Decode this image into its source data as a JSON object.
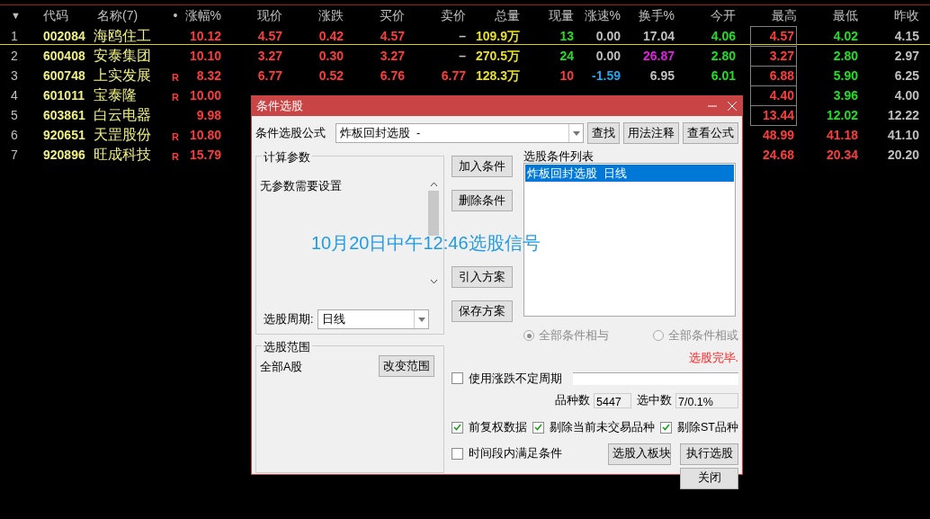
{
  "table": {
    "columns": [
      "▼",
      "代码",
      "名称(7)",
      "•",
      "涨幅%",
      "现价",
      "涨跌",
      "买价",
      "卖价",
      "总量",
      "现量",
      "涨速%",
      "换手%",
      "今开",
      "最高",
      "最低",
      "昨收"
    ],
    "rows": [
      {
        "cells": [
          {
            "text": "1"
          },
          {
            "text": "002084"
          },
          {
            "text": "海鸥住工"
          },
          null,
          {
            "text": "10.12",
            "color": "#ff3c3c"
          },
          {
            "text": "4.57",
            "color": "#ff3c3c"
          },
          {
            "text": "0.42",
            "color": "#ff3c3c"
          },
          {
            "text": "4.57",
            "color": "#ff3c3c"
          },
          {
            "text": "–",
            "color": "#c0c0c0"
          },
          {
            "text": "109.9万",
            "color": "#e8e020"
          },
          {
            "text": "13",
            "color": "#20e020"
          },
          {
            "text": "0.00",
            "color": "#c0c0c0"
          },
          {
            "text": "17.04",
            "color": "#c0c0c0"
          },
          {
            "text": "4.06",
            "color": "#20e020"
          },
          {
            "text": "4.57",
            "color": "#ff3c3c",
            "boxed": true
          },
          {
            "text": "4.02",
            "color": "#20e020"
          },
          {
            "text": "4.15",
            "color": "#c0c0c0"
          }
        ],
        "selected": true
      },
      {
        "cells": [
          {
            "text": "2"
          },
          {
            "text": "600408"
          },
          {
            "text": "安泰集团"
          },
          null,
          {
            "text": "10.10",
            "color": "#ff3c3c"
          },
          {
            "text": "3.27",
            "color": "#ff3c3c"
          },
          {
            "text": "0.30",
            "color": "#ff3c3c"
          },
          {
            "text": "3.27",
            "color": "#ff3c3c"
          },
          {
            "text": "–",
            "color": "#c0c0c0"
          },
          {
            "text": "270.5万",
            "color": "#e8e020"
          },
          {
            "text": "24",
            "color": "#20e020"
          },
          {
            "text": "0.00",
            "color": "#c0c0c0"
          },
          {
            "text": "26.87",
            "color": "#e020e0"
          },
          {
            "text": "2.80",
            "color": "#20e020"
          },
          {
            "text": "3.27",
            "color": "#ff3c3c",
            "boxed": true
          },
          {
            "text": "2.80",
            "color": "#20e020"
          },
          {
            "text": "2.97",
            "color": "#c0c0c0"
          }
        ],
        "selected": false
      },
      {
        "cells": [
          {
            "text": "3"
          },
          {
            "text": "600748"
          },
          {
            "text": "上实发展"
          },
          {
            "text": "R",
            "color": "#ff3c3c"
          },
          {
            "text": "8.32",
            "color": "#ff3c3c"
          },
          {
            "text": "6.77",
            "color": "#ff3c3c"
          },
          {
            "text": "0.52",
            "color": "#ff3c3c"
          },
          {
            "text": "6.76",
            "color": "#ff3c3c"
          },
          {
            "text": "6.77",
            "color": "#ff3c3c"
          },
          {
            "text": "128.3万",
            "color": "#e8e020"
          },
          {
            "text": "10",
            "color": "#ff3c3c"
          },
          {
            "text": "-1.59",
            "color": "#20a8f0"
          },
          {
            "text": "6.95",
            "color": "#c0c0c0"
          },
          {
            "text": "6.01",
            "color": "#20e020"
          },
          {
            "text": "6.88",
            "color": "#ff3c3c",
            "boxed": true
          },
          {
            "text": "5.90",
            "color": "#20e020"
          },
          {
            "text": "6.25",
            "color": "#c0c0c0"
          }
        ],
        "selected": false
      },
      {
        "cells": [
          {
            "text": "4"
          },
          {
            "text": "601011"
          },
          {
            "text": "宝泰隆"
          },
          {
            "text": "R",
            "color": "#ff3c3c"
          },
          {
            "text": "10.00",
            "color": "#ff3c3c"
          },
          null,
          null,
          null,
          null,
          null,
          null,
          null,
          null,
          null,
          {
            "text": "4.40",
            "color": "#ff3c3c",
            "boxed": true
          },
          {
            "text": "3.96",
            "color": "#20e020"
          },
          {
            "text": "4.00",
            "color": "#c0c0c0"
          }
        ],
        "selected": false
      },
      {
        "cells": [
          {
            "text": "5"
          },
          {
            "text": "603861"
          },
          {
            "text": "白云电器"
          },
          null,
          {
            "text": "9.98",
            "color": "#ff3c3c"
          },
          null,
          null,
          null,
          null,
          null,
          null,
          null,
          null,
          null,
          {
            "text": "13.44",
            "color": "#ff3c3c",
            "boxed": true
          },
          {
            "text": "12.02",
            "color": "#20e020"
          },
          {
            "text": "12.22",
            "color": "#c0c0c0"
          }
        ],
        "selected": false
      },
      {
        "cells": [
          {
            "text": "6"
          },
          {
            "text": "920651"
          },
          {
            "text": "天罡股份"
          },
          {
            "text": "R",
            "color": "#ff3c3c"
          },
          {
            "text": "10.80",
            "color": "#ff3c3c"
          },
          null,
          null,
          null,
          null,
          null,
          null,
          null,
          null,
          null,
          {
            "text": "48.99",
            "color": "#ff3c3c",
            "boxed": false
          },
          {
            "text": "41.18",
            "color": "#ff3c3c"
          },
          {
            "text": "41.10",
            "color": "#c0c0c0"
          }
        ],
        "selected": false
      },
      {
        "cells": [
          {
            "text": "7"
          },
          {
            "text": "920896"
          },
          {
            "text": "旺成科技"
          },
          {
            "text": "R",
            "color": "#ff3c3c"
          },
          {
            "text": "15.79",
            "color": "#ff3c3c"
          },
          null,
          null,
          null,
          null,
          null,
          null,
          null,
          null,
          null,
          {
            "text": "24.68",
            "color": "#ff3c3c",
            "boxed": false
          },
          {
            "text": "20.34",
            "color": "#ff3c3c"
          },
          {
            "text": "20.20",
            "color": "#c0c0c0"
          }
        ],
        "selected": false
      }
    ]
  },
  "dialog": {
    "title": "条件选股",
    "formula_label": "条件选股公式",
    "formula_value": "炸板回封选股  -",
    "top_buttons": [
      "查找",
      "用法注释",
      "查看公式"
    ],
    "params_group": "计算参数",
    "params_text": "无参数需要设置",
    "period_label": "选股周期:",
    "period_value": "日线",
    "range_group": "选股范围",
    "range_text": "全部A股",
    "range_button": "改变范围",
    "side_buttons": [
      "加入条件",
      "删除条件",
      "引入方案",
      "保存方案"
    ],
    "list_label": "选股条件列表",
    "list_items": [
      {
        "text": "炸板回封选股  日线",
        "selected": true
      }
    ],
    "radios": [
      {
        "label": "全部条件相与",
        "selected": true
      },
      {
        "label": "全部条件相或",
        "selected": false
      }
    ],
    "status": "选股完毕.",
    "variable_period": {
      "label": "使用涨跌不定周期",
      "checked": false
    },
    "count_label": "品种数",
    "count_value": "5447",
    "selected_label": "选中数",
    "selected_value": "7/0.1%",
    "options": [
      {
        "label": "前复权数据",
        "checked": true
      },
      {
        "label": "剔除当前未交易品种",
        "checked": true
      },
      {
        "label": "剔除ST品种",
        "checked": true
      }
    ],
    "time_range": {
      "label": "时间段内满足条件",
      "checked": false
    },
    "buttons": [
      "选股入板块",
      "执行选股"
    ],
    "close_button": "关闭",
    "annotation": "10月20日中午12:46选股信号"
  }
}
